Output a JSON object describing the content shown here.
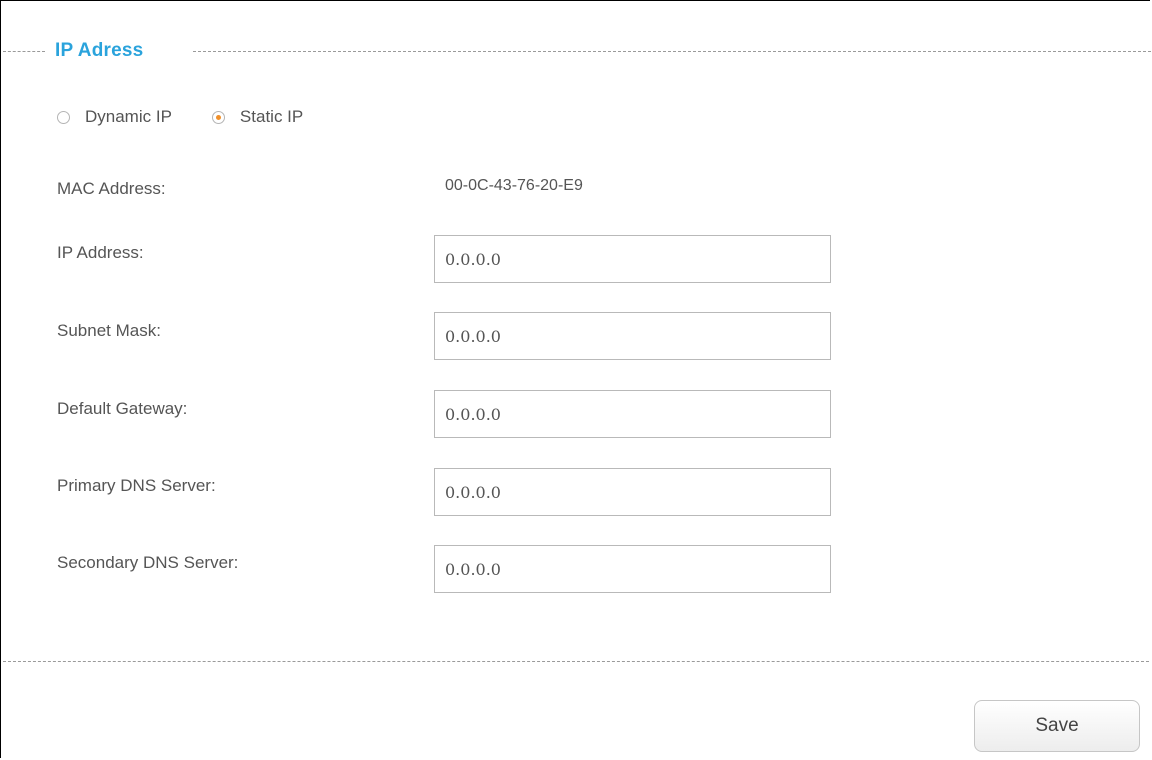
{
  "section": {
    "title": "IP Adress"
  },
  "mode": {
    "options": [
      {
        "label": "Dynamic IP",
        "selected": false
      },
      {
        "label": "Static IP",
        "selected": true
      }
    ]
  },
  "fields": {
    "mac": {
      "label": "MAC Address:",
      "value": "00-0C-43-76-20-E9"
    },
    "ip": {
      "label": "IP Address:",
      "value": "0.0.0.0"
    },
    "subnet": {
      "label": "Subnet Mask:",
      "value": "0.0.0.0"
    },
    "gateway": {
      "label": "Default Gateway:",
      "value": "0.0.0.0"
    },
    "dns1": {
      "label": "Primary DNS Server:",
      "value": "0.0.0.0"
    },
    "dns2": {
      "label": "Secondary DNS Server:",
      "value": "0.0.0.0"
    }
  },
  "actions": {
    "save_label": "Save"
  },
  "colors": {
    "accent": "#2aa3dc",
    "radio_selected": "#f0902a"
  }
}
